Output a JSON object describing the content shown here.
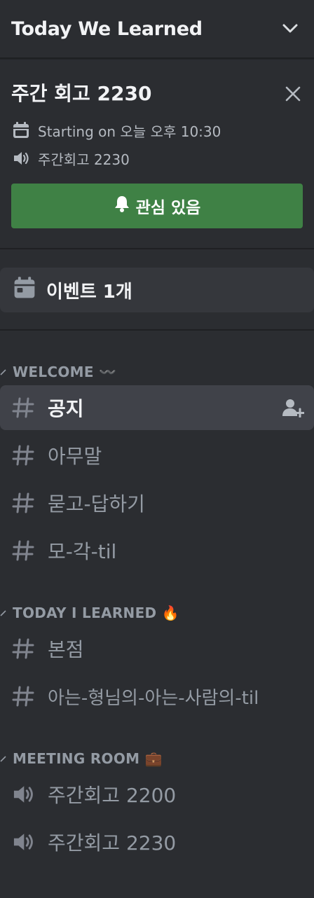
{
  "server": {
    "name": "Today We Learned"
  },
  "event": {
    "title": "주간 회고 2230",
    "time": "Starting on 오늘 오후 10:30",
    "location": "주간회고 2230",
    "interest_label": "관심 있음"
  },
  "events_row": {
    "label": "이벤트 1개"
  },
  "categories": [
    {
      "name": "WELCOME 〰️",
      "channels": [
        {
          "name": "공지",
          "type": "text",
          "active": true
        },
        {
          "name": "아무말",
          "type": "text"
        },
        {
          "name": "묻고-답하기",
          "type": "text"
        },
        {
          "name": "모-각-til",
          "type": "text"
        }
      ]
    },
    {
      "name": "TODAY I LEARNED 🔥",
      "channels": [
        {
          "name": "본점",
          "type": "text"
        },
        {
          "name": "아는-형님의-아는-사람의-til",
          "type": "text"
        }
      ]
    },
    {
      "name": "MEETING ROOM 💼",
      "channels": [
        {
          "name": "주간회고 2200",
          "type": "voice"
        },
        {
          "name": "주간회고 2230",
          "type": "voice"
        }
      ]
    }
  ],
  "colors": {
    "background": "#2b2d31",
    "active_channel": "#404249",
    "interest_button": "#3f8145",
    "muted_text": "#949ba4"
  }
}
